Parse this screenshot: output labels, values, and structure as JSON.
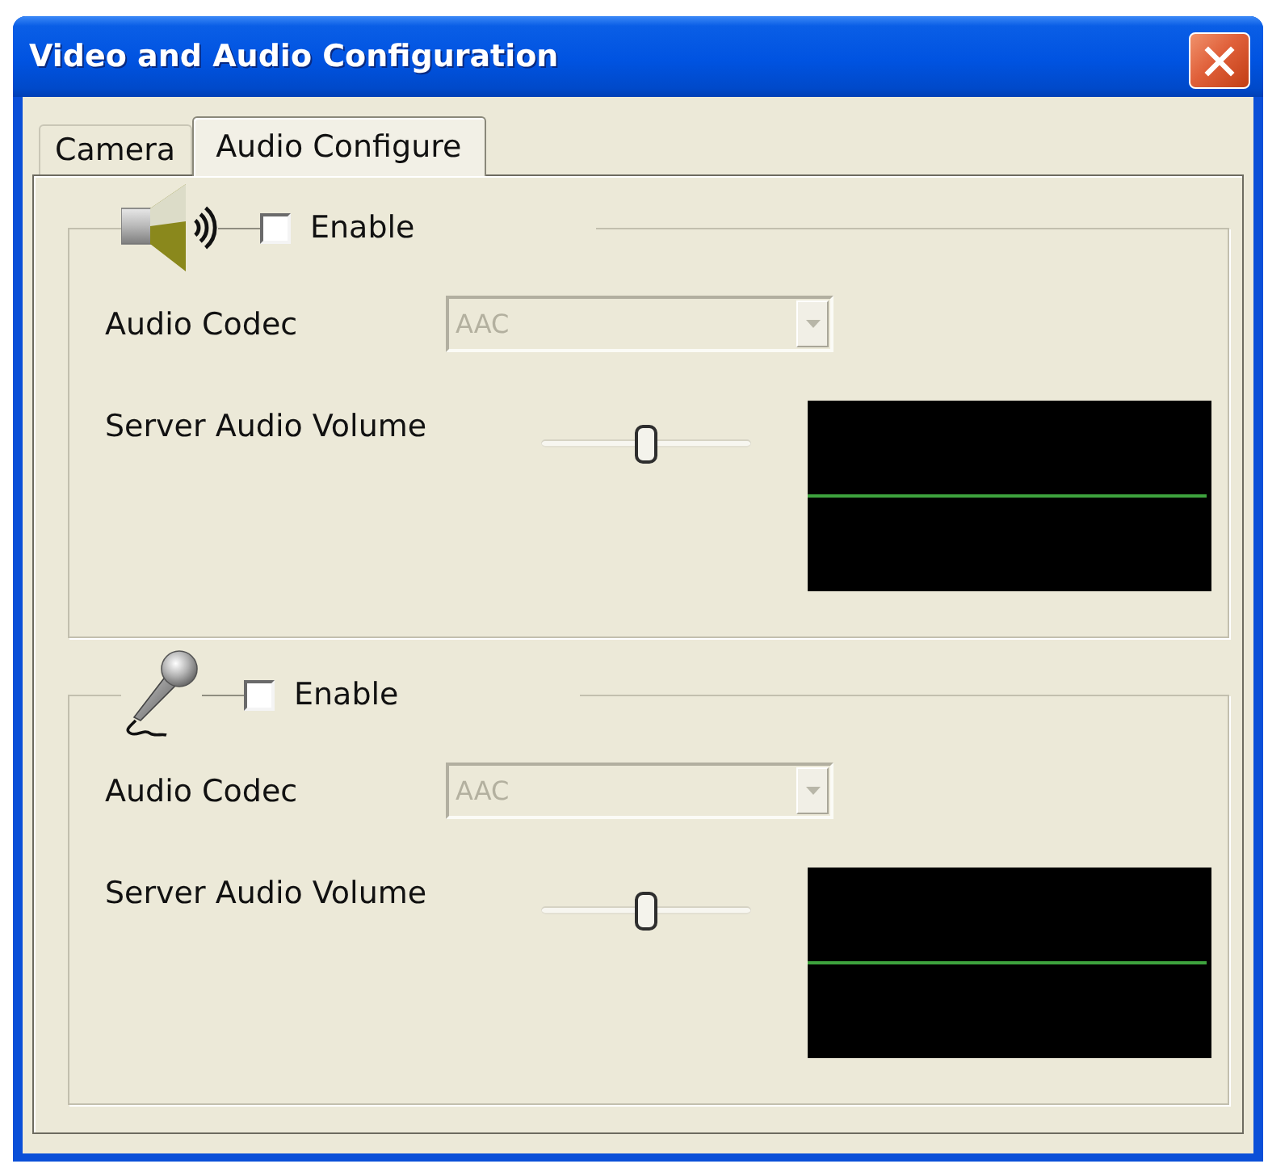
{
  "window": {
    "title": "Video and Audio Configuration"
  },
  "tabs": [
    {
      "label": "Camera",
      "selected": false
    },
    {
      "label": "Audio Configure",
      "selected": true
    }
  ],
  "groups": [
    {
      "kind": "speaker",
      "enable": {
        "label": "Enable",
        "checked": false
      },
      "codec": {
        "label": "Audio Codec",
        "value": "AAC",
        "disabled": true
      },
      "volume": {
        "label": "Server Audio Volume",
        "level": 0.5
      }
    },
    {
      "kind": "microphone",
      "enable": {
        "label": "Enable",
        "checked": false
      },
      "codec": {
        "label": "Audio Codec",
        "value": "AAC",
        "disabled": true
      },
      "volume": {
        "label": "Server Audio Volume",
        "level": 0.5
      }
    }
  ]
}
